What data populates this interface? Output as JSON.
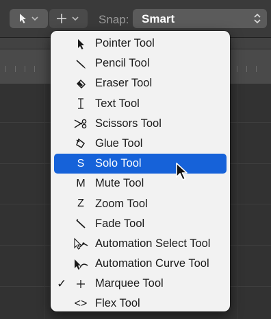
{
  "toolbar": {
    "left_tool_icon": "pointer-arrow-icon",
    "right_tool_icon": "crosshair-icon",
    "snap_label": "Snap:",
    "snap_value": "Smart"
  },
  "menu": {
    "items": [
      {
        "icon": "pointer-arrow-icon",
        "label": "Pointer Tool",
        "checked": false,
        "highlighted": false
      },
      {
        "icon": "pencil-icon",
        "label": "Pencil Tool",
        "checked": false,
        "highlighted": false
      },
      {
        "icon": "eraser-icon",
        "label": "Eraser Tool",
        "checked": false,
        "highlighted": false
      },
      {
        "icon": "text-cursor-icon",
        "label": "Text Tool",
        "checked": false,
        "highlighted": false
      },
      {
        "icon": "scissors-icon",
        "label": "Scissors Tool",
        "checked": false,
        "highlighted": false
      },
      {
        "icon": "glue-icon",
        "label": "Glue Tool",
        "checked": false,
        "highlighted": false
      },
      {
        "icon": "S",
        "label": "Solo Tool",
        "checked": false,
        "highlighted": true
      },
      {
        "icon": "M",
        "label": "Mute Tool",
        "checked": false,
        "highlighted": false
      },
      {
        "icon": "Z",
        "label": "Zoom Tool",
        "checked": false,
        "highlighted": false
      },
      {
        "icon": "fade-icon",
        "label": "Fade Tool",
        "checked": false,
        "highlighted": false
      },
      {
        "icon": "automation-select-icon",
        "label": "Automation Select Tool",
        "checked": false,
        "highlighted": false
      },
      {
        "icon": "automation-curve-icon",
        "label": "Automation Curve Tool",
        "checked": false,
        "highlighted": false
      },
      {
        "icon": "crosshair-icon",
        "label": "Marquee Tool",
        "checked": true,
        "highlighted": false
      },
      {
        "icon": "<>",
        "label": "Flex Tool",
        "checked": false,
        "highlighted": false
      }
    ],
    "check_glyph": "✓"
  },
  "colors": {
    "highlight": "#1662d9",
    "menu_bg": "#f2f2f2",
    "toolbar_bg": "#3a3a3a"
  }
}
